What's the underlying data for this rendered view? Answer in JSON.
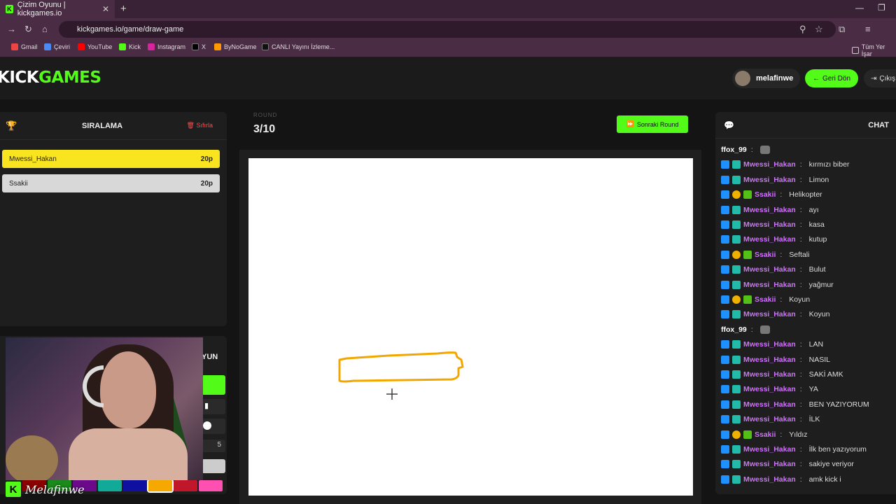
{
  "browser": {
    "tab_title": "Çizim Oyunu | kickgames.io",
    "url": "kickgames.io/game/draw-game",
    "bookmarks": [
      "Gmail",
      "Çeviri",
      "YouTube",
      "Kick",
      "Instagram",
      "X",
      "ByNoGame",
      "CANLI Yayını İzleme..."
    ],
    "all_bookmarks": "Tüm Yer İşar"
  },
  "header": {
    "logo_a": "KICK",
    "logo_b": "GAMES",
    "username": "melafinwe",
    "back_label": "Geri Dön",
    "exit_label": "Çıkış"
  },
  "ranking": {
    "title": "SIRALAMA",
    "reset_label": "Sıfırla",
    "rows": [
      {
        "name": "Mwessi_Hakan",
        "points": "20p",
        "color": "#f9e51f"
      },
      {
        "name": "Ssakii",
        "points": "20p",
        "color": "#d8d8d8"
      }
    ]
  },
  "tools": {
    "partial_label": "YUN",
    "brush_size": "5",
    "palette": [
      "#8b0000",
      "#1a8a1a",
      "#6a0a8a",
      "#11aa99",
      "#1010a0",
      "#f5a800",
      "#c0182a",
      "#ff4fb0"
    ]
  },
  "round": {
    "label": "ROUND",
    "value": "3/10",
    "next_label": "Sonraki Round"
  },
  "chat": {
    "title": "CHAT",
    "messages": [
      {
        "user": "ffox_99",
        "text": "",
        "badges": [],
        "color": "#ffffff"
      },
      {
        "user": "Mwessi_Hakan",
        "text": "kırmızı biber",
        "badges": [
          "b1",
          "b2"
        ],
        "color": "#d070ff"
      },
      {
        "user": "Mwessi_Hakan",
        "text": "Limon",
        "badges": [
          "b1",
          "b2"
        ],
        "color": "#d070ff"
      },
      {
        "user": "Ssakii",
        "text": "Helikopter",
        "badges": [
          "b1",
          "b3",
          "b4"
        ],
        "color": "#d070ff"
      },
      {
        "user": "Mwessi_Hakan",
        "text": "ayı",
        "badges": [
          "b1",
          "b2"
        ],
        "color": "#d070ff"
      },
      {
        "user": "Mwessi_Hakan",
        "text": "kasa",
        "badges": [
          "b1",
          "b2"
        ],
        "color": "#d070ff"
      },
      {
        "user": "Mwessi_Hakan",
        "text": "kutup",
        "badges": [
          "b1",
          "b2"
        ],
        "color": "#d070ff"
      },
      {
        "user": "Ssakii",
        "text": "Seftali",
        "badges": [
          "b1",
          "b3",
          "b4"
        ],
        "color": "#d070ff"
      },
      {
        "user": "Mwessi_Hakan",
        "text": "Bulut",
        "badges": [
          "b1",
          "b2"
        ],
        "color": "#d070ff"
      },
      {
        "user": "Mwessi_Hakan",
        "text": "yağmur",
        "badges": [
          "b1",
          "b2"
        ],
        "color": "#d070ff"
      },
      {
        "user": "Ssakii",
        "text": "Koyun",
        "badges": [
          "b1",
          "b3",
          "b4"
        ],
        "color": "#d070ff"
      },
      {
        "user": "Mwessi_Hakan",
        "text": "Koyun",
        "badges": [
          "b1",
          "b2"
        ],
        "color": "#d070ff"
      },
      {
        "user": "ffox_99",
        "text": "",
        "badges": [],
        "color": "#ffffff"
      },
      {
        "user": "Mwessi_Hakan",
        "text": "LAN",
        "badges": [
          "b1",
          "b2"
        ],
        "color": "#d070ff"
      },
      {
        "user": "Mwessi_Hakan",
        "text": "NASIL",
        "badges": [
          "b1",
          "b2"
        ],
        "color": "#d070ff"
      },
      {
        "user": "Mwessi_Hakan",
        "text": "SAKİ AMK",
        "badges": [
          "b1",
          "b2"
        ],
        "color": "#d070ff"
      },
      {
        "user": "Mwessi_Hakan",
        "text": "YA",
        "badges": [
          "b1",
          "b2"
        ],
        "color": "#d070ff"
      },
      {
        "user": "Mwessi_Hakan",
        "text": "BEN YAZIYORUM",
        "badges": [
          "b1",
          "b2"
        ],
        "color": "#d070ff"
      },
      {
        "user": "Mwessi_Hakan",
        "text": "İLK",
        "badges": [
          "b1",
          "b2"
        ],
        "color": "#d070ff"
      },
      {
        "user": "Ssakii",
        "text": "Yıldız",
        "badges": [
          "b1",
          "b3",
          "b4"
        ],
        "color": "#d070ff"
      },
      {
        "user": "Mwessi_Hakan",
        "text": "İlk ben yazıyorum",
        "badges": [
          "b1",
          "b2"
        ],
        "color": "#d070ff"
      },
      {
        "user": "Mwessi_Hakan",
        "text": "sakiye veriyor",
        "badges": [
          "b1",
          "b2"
        ],
        "color": "#d070ff"
      },
      {
        "user": "Mwessi_Hakan",
        "text": "amk kick i",
        "badges": [
          "b1",
          "b2"
        ],
        "color": "#d070ff"
      }
    ]
  },
  "stream": {
    "streamer_name": "Melafinwe",
    "k_badge": "K"
  },
  "colors": {
    "accent": "#53fc18",
    "stroke": "#f2a600"
  }
}
